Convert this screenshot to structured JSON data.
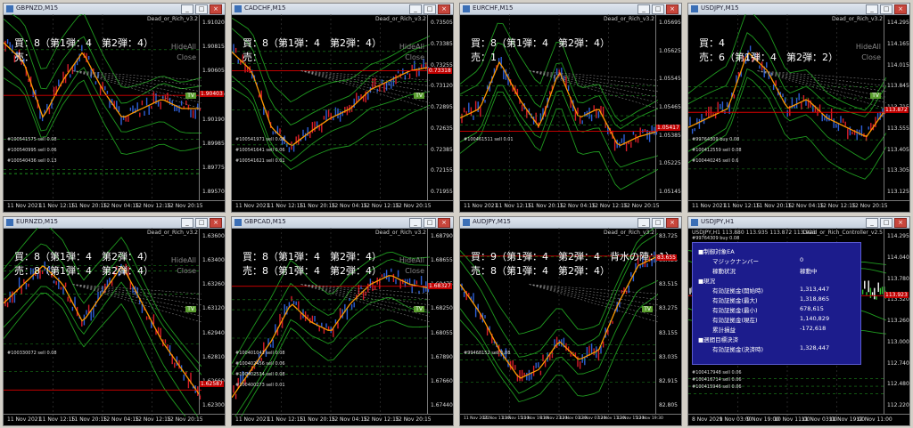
{
  "charts": [
    {
      "title": "GBPNZD,M15",
      "ea": "Dead_or_Rich_v3.2",
      "buy_line": "買：8（第1弾：4　第2弾：4）",
      "sell_line": "売：",
      "hide": "HideAll",
      "close": "Close",
      "tv": "TV",
      "yticks": [
        "1.91020",
        "1.90815",
        "1.90605",
        "1.90400",
        "1.90190",
        "1.89985",
        "1.89775",
        "1.89570"
      ],
      "price_box": "1.90403",
      "xticks": [
        "11 Nov 2021",
        "11 Nov 12:15",
        "11 Nov 20:15",
        "12 Nov 04:15",
        "12 Nov 12:15",
        "12 Nov 20:15"
      ],
      "sub": [
        "21",
        "12",
        "3"
      ],
      "orders": [
        "#100541575 sell 0.08",
        "#100540995 sell 0.06",
        "#100540436 sell 0.13"
      ]
    },
    {
      "title": "CADCHF,M15",
      "ea": "Dead_or_Rich_v3.2",
      "buy_line": "買：8（第1弾：4　第2弾：4）",
      "sell_line": "売：",
      "hide": "HideAll",
      "close": "Close",
      "tv": "TV",
      "yticks": [
        "0.73505",
        "0.73385",
        "0.73255",
        "0.73120",
        "0.72895",
        "0.72635",
        "0.72385",
        "0.72155",
        "0.71955"
      ],
      "price_box": "0.73318",
      "xticks": [
        "11 Nov 2021",
        "11 Nov 12:15",
        "11 Nov 20:15",
        "12 Nov 04:15",
        "12 Nov 12:15",
        "12 Nov 20:15"
      ],
      "sub": [
        "12",
        "3",
        "18"
      ],
      "orders": [
        "#100541971 sell 0.08",
        "#100541641 sell 0.06",
        "#100541621 sell 0.01"
      ]
    },
    {
      "title": "EURCHF,M15",
      "ea": "Dead_or_Rich_v3.2",
      "buy_line": "買：8（第1弾：4　第2弾：4）",
      "sell_line": "売：1",
      "hide": "",
      "close": "",
      "tv": "",
      "yticks": [
        "1.05695",
        "1.05625",
        "1.05545",
        "1.05465",
        "1.05385",
        "1.05225",
        "1.05145"
      ],
      "price_box": "1.05417",
      "xticks": [
        "11 Nov 2021",
        "11 Nov 12:15",
        "11 Nov 20:15",
        "12 Nov 04:15",
        "12 Nov 12:15",
        "12 Nov 20:15"
      ],
      "sub": [
        "21",
        "3",
        "12"
      ],
      "orders": [
        "#100461511 sell 0.01"
      ]
    },
    {
      "title": "USDJPY,M15",
      "ea": "Dead_or_Rich_v3.2",
      "buy_line": "買：4",
      "sell_line": "売：6（第1弾：4　第2弾：2）",
      "hide": "HideAll",
      "close": "Close",
      "tv": "TV",
      "yticks": [
        "114.295",
        "114.165",
        "114.015",
        "113.845",
        "113.715",
        "113.555",
        "113.405",
        "113.305",
        "113.125"
      ],
      "price_box": "113.872",
      "xticks": [
        "11 Nov 2021",
        "11 Nov 12:15",
        "11 Nov 20:15",
        "12 Nov 04:15",
        "12 Nov 12:15",
        "12 Nov 20:15"
      ],
      "sub": [
        "21",
        "12",
        "3"
      ],
      "orders": [
        "#99764309 buy 0.08",
        "#100412559 sell 0.08",
        "#100440245 sell 0.6"
      ]
    },
    {
      "title": "EURNZD,M15",
      "ea": "Dead_or_Rich_v3.2",
      "buy_line": "買：8（第1弾：4　第2弾：4）",
      "sell_line": "売：8（第1弾：4　第2弾：4）",
      "hide": "HideAll",
      "close": "Close",
      "tv": "TV",
      "yticks": [
        "1.63600",
        "1.63400",
        "1.63260",
        "1.63120",
        "1.62940",
        "1.62810",
        "1.62660",
        "1.62300"
      ],
      "price_box": "1.62587",
      "xticks": [
        "11 Nov 2021",
        "11 Nov 12:15",
        "11 Nov 20:15",
        "12 Nov 04:15",
        "12 Nov 12:15",
        "12 Nov 20:15"
      ],
      "sub": [
        "21",
        "12",
        "3"
      ],
      "orders": [
        "#100330072 sell 0.08"
      ]
    },
    {
      "title": "GBPCAD,M15",
      "ea": "Dead_or_Rich_v3.2",
      "buy_line": "買：8（第1弾：4　第2弾：4）",
      "sell_line": "売：8（第1弾：4　第2弾：4）",
      "hide": "HideAll",
      "close": "Close",
      "tv": "TV",
      "yticks": [
        "1.68790",
        "1.68655",
        "1.68475",
        "1.68250",
        "1.68055",
        "1.67890",
        "1.67660",
        "1.67440"
      ],
      "price_box": "1.68327",
      "xticks": [
        "11 Nov 2021",
        "11 Nov 12:15",
        "11 Nov 20:15",
        "12 Nov 04:15",
        "12 Nov 12:15",
        "12 Nov 20:15"
      ],
      "sub": [
        "12",
        "3",
        "18"
      ],
      "orders": [
        "#100401041 sell 0.08",
        "#100402456 sell 0.06",
        "#100402534 sell 0.08",
        "#100400273 sell 0.01"
      ]
    },
    {
      "title": "AUDJPY,M15",
      "ea": "Dead_or_Rich_v3.2",
      "buy_line": "買：9（第1弾：4　第2弾：4　背水の陣：1）",
      "sell_line": "売：8（第1弾：4　第2弾：4）",
      "hide": "",
      "close": "",
      "tv": "TV",
      "yticks": [
        "83.725",
        "83.625",
        "83.515",
        "83.275",
        "83.155",
        "83.035",
        "82.915",
        "82.805"
      ],
      "price_box": "83.655",
      "xticks": [
        "11 Nov 2021",
        "11 Nov 11:30",
        "11 Nov 15:30",
        "11 Nov 19:30",
        "11 Nov 23:30",
        "12 Nov 03:30",
        "12 Nov 07:30",
        "12 Nov 11:30",
        "12 Nov 15:30",
        "12 Nov 19:30"
      ],
      "sub": [
        "12",
        "3",
        "12",
        "3"
      ],
      "orders": [
        "#99468152 sell 0.08"
      ]
    }
  ],
  "controller": {
    "title": "USDJPY,H1",
    "ohlc": "USDJPY,H1  113.880 113.935 113.872 113.923",
    "ea": "Dead_or_Rich_Controller_v2.5",
    "order_top": "#99764309 buy 0.08",
    "yticks": [
      "114.295",
      "114.040",
      "113.780",
      "113.520",
      "113.260",
      "113.000",
      "112.740",
      "112.480",
      "112.220"
    ],
    "price_box": "113.923",
    "xticks": [
      "8 Nov 2021",
      "9 Nov 03:00",
      "9 Nov 19:00",
      "10 Nov 11:00",
      "11 Nov 03:00",
      "11 Nov 19:00",
      "12 Nov 11:00"
    ],
    "orders_bottom": [
      "#100417948 sell 0.06",
      "#100416714 sell 0.06",
      "#100415946 sell 0.06"
    ],
    "panel": {
      "h1": "■制御対象EA",
      "magic_label": "マジックナンバー",
      "magic_value": "0",
      "status_label": "稼動状況",
      "status_value": "稼動中",
      "h2": "■現況",
      "rows": [
        {
          "label": "有効証拠金(開始時)",
          "value": "1,313,447"
        },
        {
          "label": "有効証拠金(最大)",
          "value": "1,318,865"
        },
        {
          "label": "有効証拠金(最小)",
          "value": "678,615"
        },
        {
          "label": "有効証拠金(現在)",
          "value": "1,140,829"
        },
        {
          "label": "累計損益",
          "value": "-172,618"
        }
      ],
      "h3": "■週間目標決済",
      "target_label": "有効証拠金(決済時)",
      "target_value": "1,328,447"
    }
  },
  "colors": {
    "bg": "#000000",
    "bull": "#2e5fd6",
    "bear": "#d81e2a",
    "bands": "#1f9a1f",
    "ma": "#ff9a00",
    "panel": "#1c1c8c"
  }
}
